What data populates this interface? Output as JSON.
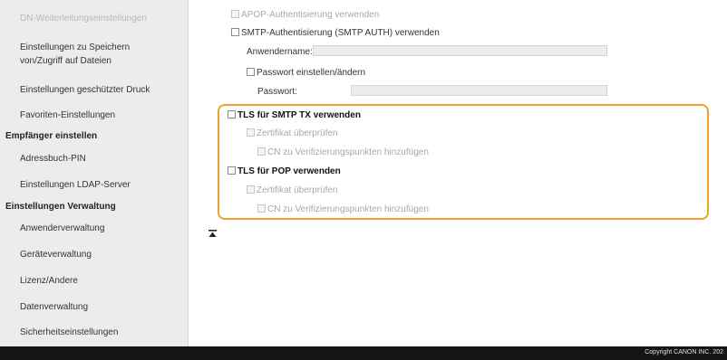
{
  "sidebar": {
    "items": [
      "DN-Weiterleitungseinstellungen",
      "Einstellungen zu Speichern",
      "von/Zugriff auf Dateien",
      "Einstellungen geschützter Druck",
      "Favoriten-Einstellungen",
      "Empfänger einstellen",
      "Adressbuch-PIN",
      "Einstellungen LDAP-Server",
      "Einstellungen Verwaltung",
      "Anwenderverwaltung",
      "Geräteverwaltung",
      "Lizenz/Andere",
      "Datenverwaltung",
      "Sicherheitseinstellungen"
    ]
  },
  "form": {
    "apop": "APOP-Authentisierung verwenden",
    "smtp_auth": "SMTP-Authentisierung (SMTP AUTH) verwenden",
    "username_label": "Anwendername:",
    "username_value": "",
    "set_password": "Passwort einstellen/ändern",
    "password_label": "Passwort:",
    "password_value": "",
    "tls_smtp": "TLS für SMTP TX verwenden",
    "verify_cert_1": "Zertifikat überprüfen",
    "cn_1": "CN zu Verifizierungspunkten hinzufügen",
    "tls_pop": "TLS für POP verwenden",
    "verify_cert_2": "Zertifikat überprüfen",
    "cn_2": "CN zu Verifizierungspunkten hinzufügen"
  },
  "footer": {
    "copyright": "Copyright CANON INC. 202"
  },
  "colors": {
    "highlight": "#f0a12a",
    "sidebar_bg": "#ececec",
    "footer_bg": "#141414"
  }
}
